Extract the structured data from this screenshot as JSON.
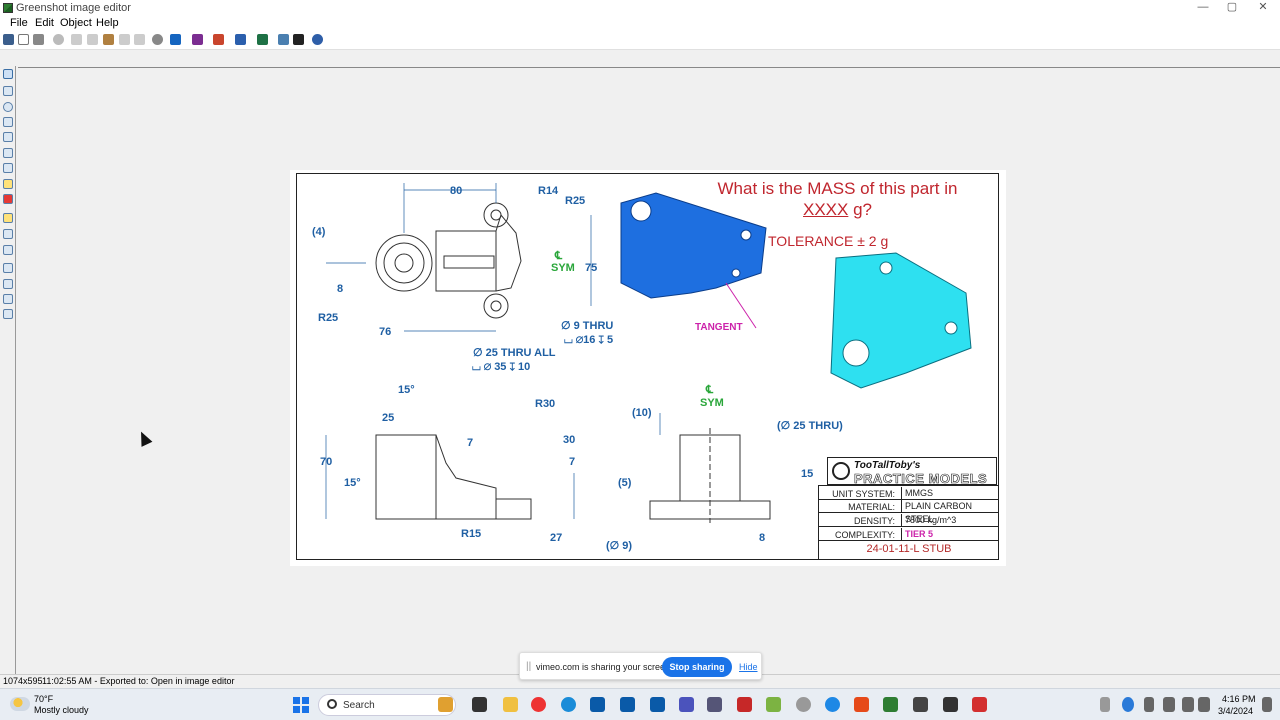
{
  "window": {
    "title": "Greenshot image editor"
  },
  "menu": [
    "File",
    "Edit",
    "Object",
    "Help"
  ],
  "drawing": {
    "question_line1": "What is the MASS of this part in",
    "question_unit": "XXXX",
    "question_suffix": " g?",
    "tolerance": "TOLERANCE ± 2 g",
    "tangent": "TANGENT",
    "dims": {
      "d80": "80",
      "r14": "R14",
      "r25a": "R25",
      "d4": "(4)",
      "sym1_c": "℄",
      "sym1": "SYM",
      "d75": "75",
      "d8a": "8",
      "r25b": "R25",
      "d76": "76",
      "hole9": "∅ 9 THRU",
      "cbore16": "⌴ ∅16 ↧ 5",
      "hole25": "∅ 25 THRU ALL",
      "cbore35": "⌴ ∅ 35 ↧ 10",
      "a15a": "15°",
      "d25": "25",
      "r30": "R30",
      "d7a": "7",
      "d30": "30",
      "d70": "70",
      "a15b": "15°",
      "d7b": "7",
      "r15": "R15",
      "d27": "27",
      "sym2_c": "℄",
      "sym2": "SYM",
      "d10": "(10)",
      "hole25b": "(∅ 25 THRU)",
      "d15": "15",
      "d5": "(5)",
      "d9": "(∅ 9)",
      "d8b": "8"
    },
    "brand_top": "TooTallToby's",
    "brand_bottom": "PRACTICE MODELS",
    "title_block": [
      {
        "key": "UNIT SYSTEM:",
        "value": "MMGS"
      },
      {
        "key": "MATERIAL:",
        "value": "PLAIN CARBON STEEL"
      },
      {
        "key": "DENSITY:",
        "value": "7800 kg/m^3"
      },
      {
        "key": "COMPLEXITY:",
        "value": "TIER 5"
      }
    ],
    "part_number": "24-01-11-L STUB"
  },
  "status": {
    "size": "1074x595",
    "message": "11:02:55 AM - Exported to: Open in image editor"
  },
  "share": {
    "grip": "||",
    "text": "vimeo.com is sharing your screen.",
    "stop": "Stop sharing",
    "hide": "Hide"
  },
  "taskbar": {
    "temp": "70°F",
    "weather": "Mostly cloudy",
    "search": "Search",
    "time": "4:16 PM",
    "date": "3/4/2024"
  },
  "window_buttons": {
    "minimize": "—",
    "maximize": "▢",
    "close": "✕"
  }
}
